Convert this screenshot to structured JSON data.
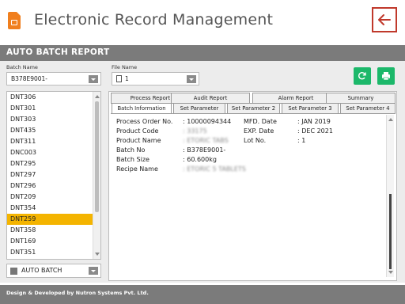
{
  "header": {
    "title": "Electronic Record Management"
  },
  "band": {
    "title": "AUTO BATCH REPORT"
  },
  "filters": {
    "batch_label": "Batch Name",
    "batch_value": "B378E9001-",
    "file_label": "File Name",
    "file_value": "1"
  },
  "list": {
    "items": [
      "DNT306",
      "DNT301",
      "DNT303",
      "DNT435",
      "DNT311",
      "DNC003",
      "DNT295",
      "DNT297",
      "DNT296",
      "DNT209",
      "DNT354",
      "DNT259",
      "DNT358",
      "DNT169",
      "DNT351"
    ],
    "selected": "DNT259"
  },
  "mode_select": {
    "value": "AUTO BATCH"
  },
  "tabs_top": [
    "Process Report",
    "Audit Report",
    "Alarm Report",
    "Summary"
  ],
  "tabs_bottom": [
    "Batch Information",
    "Set Parameter",
    "Set Parameter 2",
    "Set Parameter 3",
    "Set Parameter 4"
  ],
  "active_tab": "Batch Information",
  "batch_info": {
    "process_order_label": "Process Order No.",
    "process_order_value": ": 10000094344",
    "product_code_label": "Product Code",
    "product_code_value": ": 33175",
    "product_name_label": "Product Name",
    "product_name_value": ": ETORIC TABS",
    "batch_no_label": "Batch No",
    "batch_no_value": ": B378E9001-",
    "batch_size_label": "Batch Size",
    "batch_size_value": ": 60.600kg",
    "recipe_name_label": "Recipe Name",
    "recipe_name_value": ": ETORIC 5 TABLETS",
    "mfd_label": "MFD. Date",
    "mfd_value": ": JAN 2019",
    "exp_label": "EXP. Date",
    "exp_value": ": DEC 2021",
    "lot_label": "Lot No.",
    "lot_value": ": 1"
  },
  "footer": {
    "text": "Design & Developed by Nutron Systems Pvt. Ltd."
  },
  "colors": {
    "accent_green": "#1cb86a",
    "selection": "#f4b400",
    "band": "#7b7b7b",
    "back_border": "#c0392b",
    "logo": "#f07f1e"
  }
}
